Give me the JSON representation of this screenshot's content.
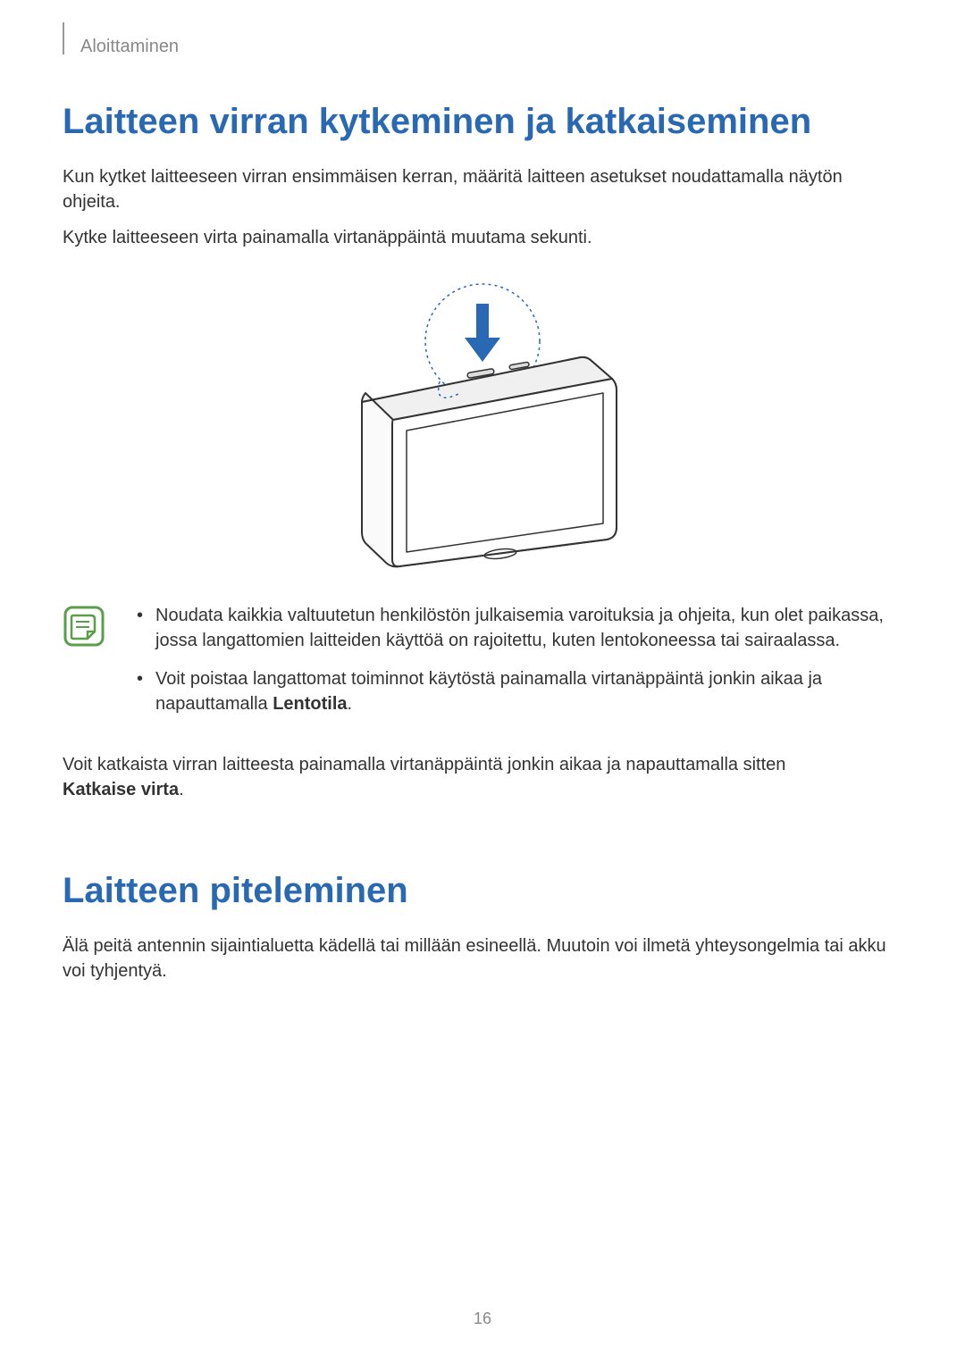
{
  "header": {
    "section": "Aloittaminen"
  },
  "section1": {
    "heading": "Laitteen virran kytkeminen ja katkaiseminen",
    "para1": "Kun kytket laitteeseen virran ensimmäisen kerran, määritä laitteen asetukset noudattamalla näytön ohjeita.",
    "para2": "Kytke laitteeseen virta painamalla virtanäppäintä muutama sekunti.",
    "note_bullet1": "Noudata kaikkia valtuutetun henkilöstön julkaisemia varoituksia ja ohjeita, kun olet paikassa, jossa langattomien laitteiden käyttöä on rajoitettu, kuten lentokoneessa tai sairaalassa.",
    "note_bullet2_pre": "Voit poistaa langattomat toiminnot käytöstä painamalla virtanäppäintä jonkin aikaa ja napauttamalla ",
    "note_bullet2_bold": "Lentotila",
    "note_bullet2_post": ".",
    "para3_pre": "Voit katkaista virran laitteesta painamalla virtanäppäintä jonkin aikaa ja napauttamalla sitten ",
    "para3_bold": "Katkaise virta",
    "para3_post": "."
  },
  "section2": {
    "heading": "Laitteen piteleminen",
    "para1": "Älä peitä antennin sijaintialuetta kädellä tai millään esineellä. Muutoin voi ilmetä yhteysongelmia tai akku voi tyhjentyä."
  },
  "pageNumber": "16"
}
